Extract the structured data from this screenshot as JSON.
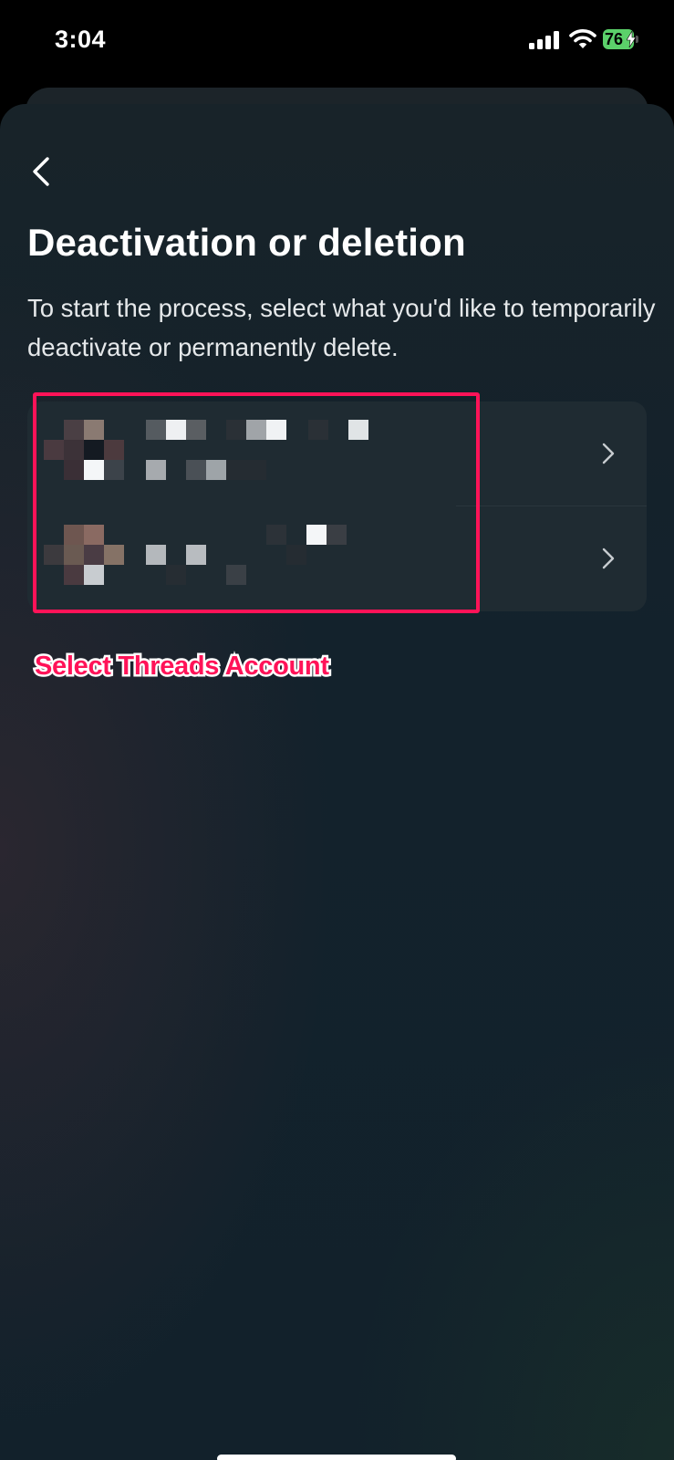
{
  "status_bar": {
    "time": "3:04",
    "battery_level": "76",
    "icons": [
      "signal-icon",
      "wifi-icon",
      "battery-charging-icon"
    ]
  },
  "header": {
    "back_icon": "chevron-left-icon",
    "title": "Deactivation or deletion",
    "subtitle": "To start the process, select what you'd like to temporarily deactivate or permanently delete."
  },
  "accounts": {
    "items": [
      {
        "icon": "chevron-right-icon"
      },
      {
        "icon": "chevron-right-icon"
      }
    ]
  },
  "annotation": {
    "label": "Select Threads Account",
    "color": "#ff1358"
  },
  "colors": {
    "accent": "#ff1358",
    "card": "#1f2b32",
    "battery": "#5bd16a"
  }
}
